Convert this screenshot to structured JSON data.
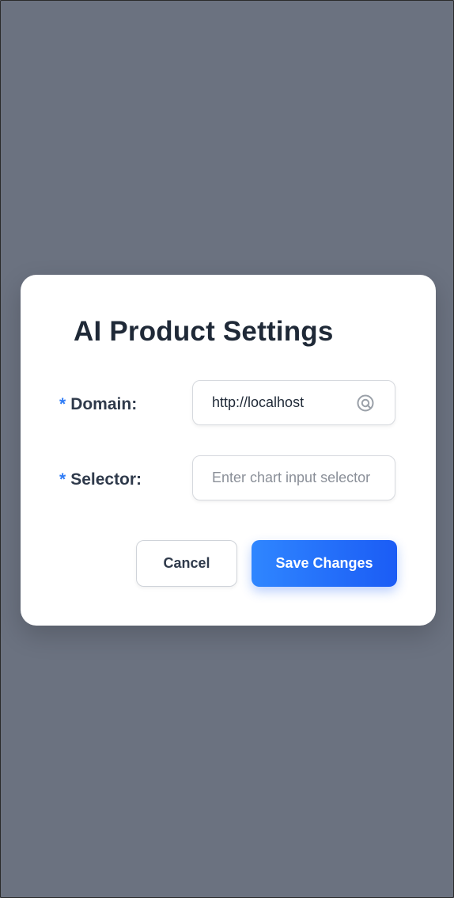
{
  "dialog": {
    "title": "AI Product Settings",
    "required_marker": "*"
  },
  "fields": {
    "domain": {
      "label": "Domain:",
      "value": "http://localhost",
      "icon": "target-icon"
    },
    "selector": {
      "label": "Selector:",
      "value": "",
      "placeholder": "Enter chart input selector"
    }
  },
  "buttons": {
    "cancel_label": "Cancel",
    "save_label": "Save Changes"
  },
  "colors": {
    "overlay": "#6b7280",
    "accent": "#2f7cf6",
    "primary_gradient_start": "#2f86ff",
    "primary_gradient_end": "#1b5cf5",
    "title_text": "#1f2937"
  }
}
